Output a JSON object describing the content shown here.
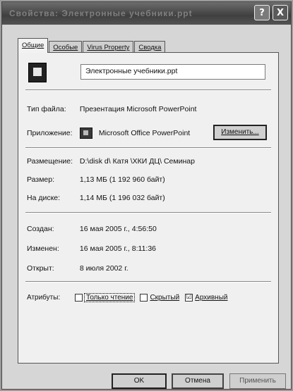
{
  "window": {
    "title": "Свойства: Электронные учебники.ppt"
  },
  "titlebar": {
    "help_glyph": "?",
    "close_glyph": "X"
  },
  "tabs": [
    {
      "label": "Общие",
      "active": true
    },
    {
      "label": "Особые"
    },
    {
      "label": "Virus Property"
    },
    {
      "label": "Сводка"
    }
  ],
  "file": {
    "name": "Электронные учебники.ppt"
  },
  "info": {
    "type_label": "Тип файла:",
    "type_value": "Презентация Microsoft PowerPoint",
    "app_label": "Приложение:",
    "app_value": "Microsoft Office PowerPoint",
    "change_button": "Изменить..."
  },
  "location": {
    "location_label": "Размещение:",
    "location_value": "D:\\disk d\\ Катя \\ХКИ ДЦ\\ Семинар",
    "size_label": "Размер:",
    "size_value": "1,13 МБ (1 192 960 байт)",
    "disk_label": "На диске:",
    "disk_value": "1,14 МБ (1 196 032 байт)"
  },
  "dates": {
    "created_label": "Создан:",
    "created_value": "16 мая 2005 г., 4:56:50",
    "modified_label": "Изменен:",
    "modified_value": "16 мая 2005 г., 8:11:36",
    "opened_label": "Открыт:",
    "opened_value": "8 июля 2002 г."
  },
  "attributes": {
    "label": "Атрибуты:",
    "readonly": {
      "label": "Только чтение",
      "checked": false
    },
    "hidden": {
      "label": "Скрытый",
      "checked": false
    },
    "archive": {
      "label": "Архивный",
      "checked": true,
      "mark": "☑"
    }
  },
  "footer": {
    "ok": "OK",
    "cancel": "Отмена",
    "apply": "Применить"
  }
}
